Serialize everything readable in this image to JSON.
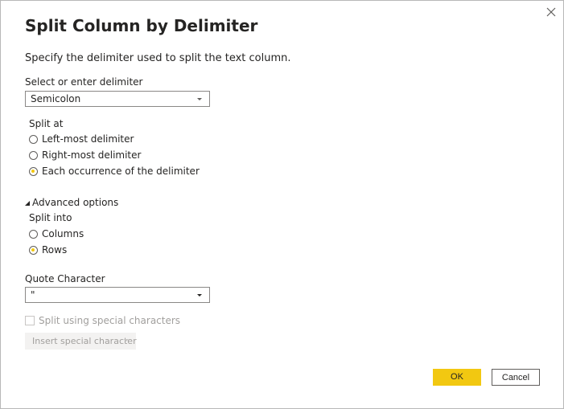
{
  "dialog": {
    "title": "Split Column by Delimiter",
    "description": "Specify the delimiter used to split the text column.",
    "close_icon": "close-icon"
  },
  "delimiter": {
    "label": "Select or enter delimiter",
    "value": "Semicolon"
  },
  "split_at": {
    "label": "Split at",
    "options": [
      {
        "label": "Left-most delimiter",
        "selected": false
      },
      {
        "label": "Right-most delimiter",
        "selected": false
      },
      {
        "label": "Each occurrence of the delimiter",
        "selected": true
      }
    ]
  },
  "advanced": {
    "label": "Advanced options",
    "expanded": true
  },
  "split_into": {
    "label": "Split into",
    "options": [
      {
        "label": "Columns",
        "selected": false
      },
      {
        "label": "Rows",
        "selected": true
      }
    ]
  },
  "quote": {
    "label": "Quote Character",
    "value": "\""
  },
  "special": {
    "checkbox_label": "Split using special characters",
    "checked": false,
    "insert_label": "Insert special character"
  },
  "buttons": {
    "ok": "OK",
    "cancel": "Cancel"
  },
  "colors": {
    "accent": "#f2c811",
    "text": "#252423",
    "disabled_text": "#a19f9d"
  }
}
